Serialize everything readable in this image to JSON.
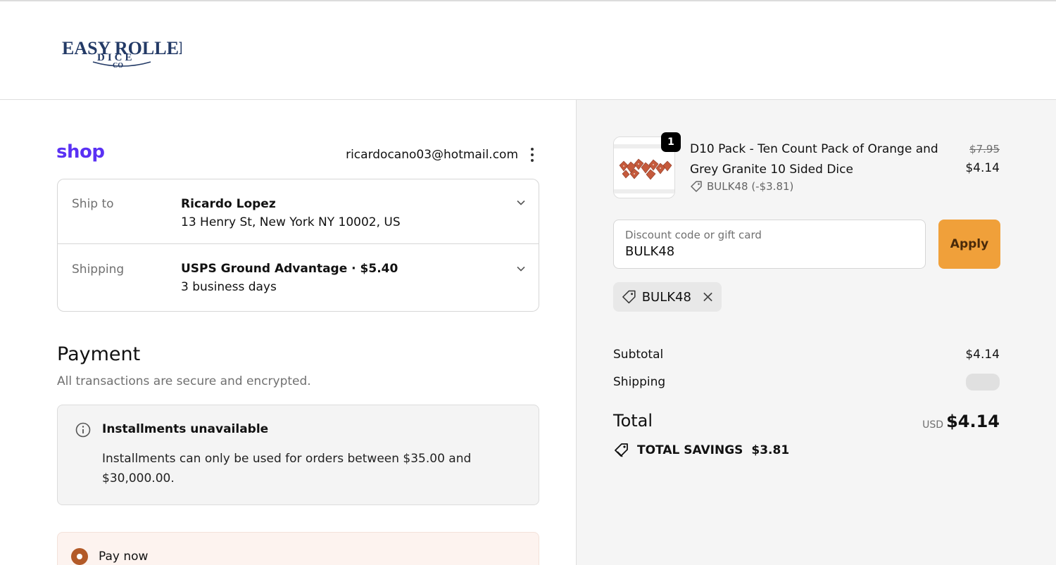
{
  "brand": {
    "logo_line1": "EASY ROLLER",
    "logo_line2": "DICE",
    "logo_line3": "CO"
  },
  "account": {
    "shop_logo": "shop",
    "email": "ricardocano03@hotmail.com"
  },
  "review": {
    "ship_to_label": "Ship to",
    "ship_to_name": "Ricardo Lopez",
    "ship_to_address": "13 Henry St, New York NY 10002, US",
    "shipping_label": "Shipping",
    "shipping_method": "USPS Ground Advantage · $5.40",
    "shipping_time": "3 business days"
  },
  "payment": {
    "title": "Payment",
    "subtitle": "All transactions are secure and encrypted.",
    "notice_title": "Installments unavailable",
    "notice_text": "Installments can only be used for orders between $35.00 and $30,000.00.",
    "paynow_label": "Pay now"
  },
  "order": {
    "item": {
      "quantity": "1",
      "name": "D10 Pack - Ten Count Pack of Orange and Grey Granite 10 Sided Dice",
      "discount": "BULK48 (-$3.81)",
      "original_price": "$7.95",
      "price": "$4.14"
    },
    "discount_field": {
      "label": "Discount code or gift card",
      "value": "BULK48"
    },
    "apply_label": "Apply",
    "applied_code": "BULK48",
    "subtotal_label": "Subtotal",
    "subtotal_value": "$4.14",
    "shipping_label": "Shipping",
    "total_label": "Total",
    "total_currency": "USD",
    "total_value": "$4.14",
    "savings_label": "TOTAL SAVINGS",
    "savings_value": "$3.81"
  },
  "colors": {
    "shop_purple": "#5a31f4",
    "apply_orange": "#f0a03a",
    "radio_brown": "#b35a28",
    "logo_navy": "#233a66"
  }
}
